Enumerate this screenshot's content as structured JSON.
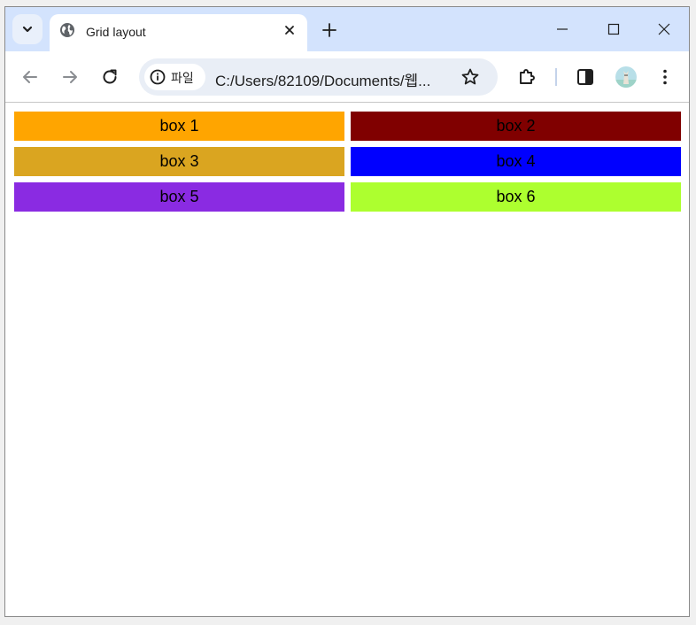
{
  "browser": {
    "tab": {
      "title": "Grid layout",
      "favicon": "globe-icon"
    },
    "addressbar": {
      "chip_label": "파일",
      "url": "C:/Users/82109/Documents/웹..."
    },
    "colors": {
      "tabstrip_bg": "#d3e3fd",
      "omnibox_bg": "#e9eef6"
    }
  },
  "page": {
    "boxes": [
      {
        "label": "box 1",
        "color": "#ffa500"
      },
      {
        "label": "box 2",
        "color": "#800000"
      },
      {
        "label": "box 3",
        "color": "#daa520"
      },
      {
        "label": "box 4",
        "color": "#0000ff"
      },
      {
        "label": "box 5",
        "color": "#8a2be2"
      },
      {
        "label": "box 6",
        "color": "#adff2f"
      }
    ]
  }
}
